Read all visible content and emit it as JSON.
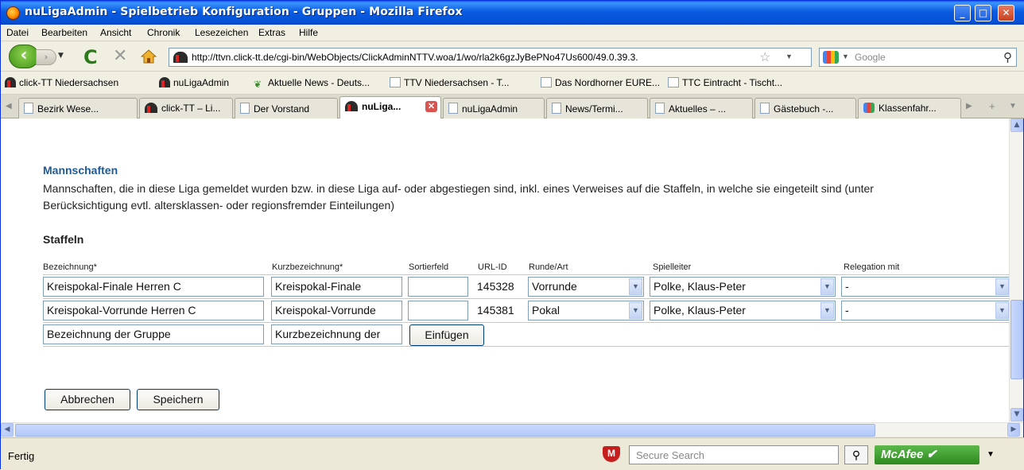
{
  "window": {
    "title": "nuLigaAdmin - Spielbetrieb Konfiguration - Gruppen - Mozilla Firefox"
  },
  "menu": [
    "Datei",
    "Bearbeiten",
    "Ansicht",
    "Chronik",
    "Lesezeichen",
    "Extras",
    "Hilfe"
  ],
  "nav": {
    "url": "http://ttvn.click-tt.de/cgi-bin/WebObjects/ClickAdminNTTV.woa/1/wo/rla2k6gzJyBePNo47Us600/49.0.39.3.",
    "search_placeholder": "Google"
  },
  "bookmarks": [
    "click-TT Niedersachsen",
    "nuLigaAdmin",
    "Aktuelle News - Deuts...",
    "TTV Niedersachsen - T...",
    "Das Nordhorner EURE...",
    "TTC Eintracht - Tischt..."
  ],
  "tabs": [
    "Bezirk Wese...",
    "click-TT – Li...",
    "Der Vorstand",
    "nuLiga...",
    "nuLigaAdmin",
    "News/Termi...",
    "Aktuelles – ...",
    "Gästebuch -...",
    "Klassenfahr..."
  ],
  "main": {
    "section_title": "Mannschaften",
    "section_text": "Mannschaften, die in diese Liga gemeldet wurden bzw. in diese Liga auf- oder abgestiegen sind, inkl. eines Verweises auf die Staffeln, in welche sie eingeteilt sind (unter Berücksichtigung evtl. altersklassen- oder regionsfremder Einteilungen)",
    "staffeln_title": "Staffeln",
    "columns": [
      "Bezeichnung*",
      "Kurzbezeichnung*",
      "Sortierfeld",
      "URL-ID",
      "Runde/Art",
      "Spielleiter",
      "Relegation mit"
    ],
    "rows": [
      {
        "bezeichnung": "Kreispokal-Finale Herren C",
        "kurz": "Kreispokal-Finale",
        "sort": "",
        "urlid": "145328",
        "runde": "Vorrunde",
        "spielleiter": "Polke, Klaus-Peter",
        "relegation": "-"
      },
      {
        "bezeichnung": "Kreispokal-Vorrunde Herren C",
        "kurz": "Kreispokal-Vorrunde",
        "sort": "",
        "urlid": "145381",
        "runde": "Pokal",
        "spielleiter": "Polke, Klaus-Peter",
        "relegation": "-"
      }
    ],
    "new_row": {
      "bezeichnung_placeholder": "Bezeichnung der Gruppe",
      "kurz_placeholder": "Kurzbezeichnung der",
      "insert_label": "Einfügen"
    },
    "cancel_label": "Abbrechen",
    "save_label": "Speichern"
  },
  "status": {
    "text": "Fertig",
    "secure_search_placeholder": "Secure Search",
    "mcafee_label": "McAfee"
  }
}
